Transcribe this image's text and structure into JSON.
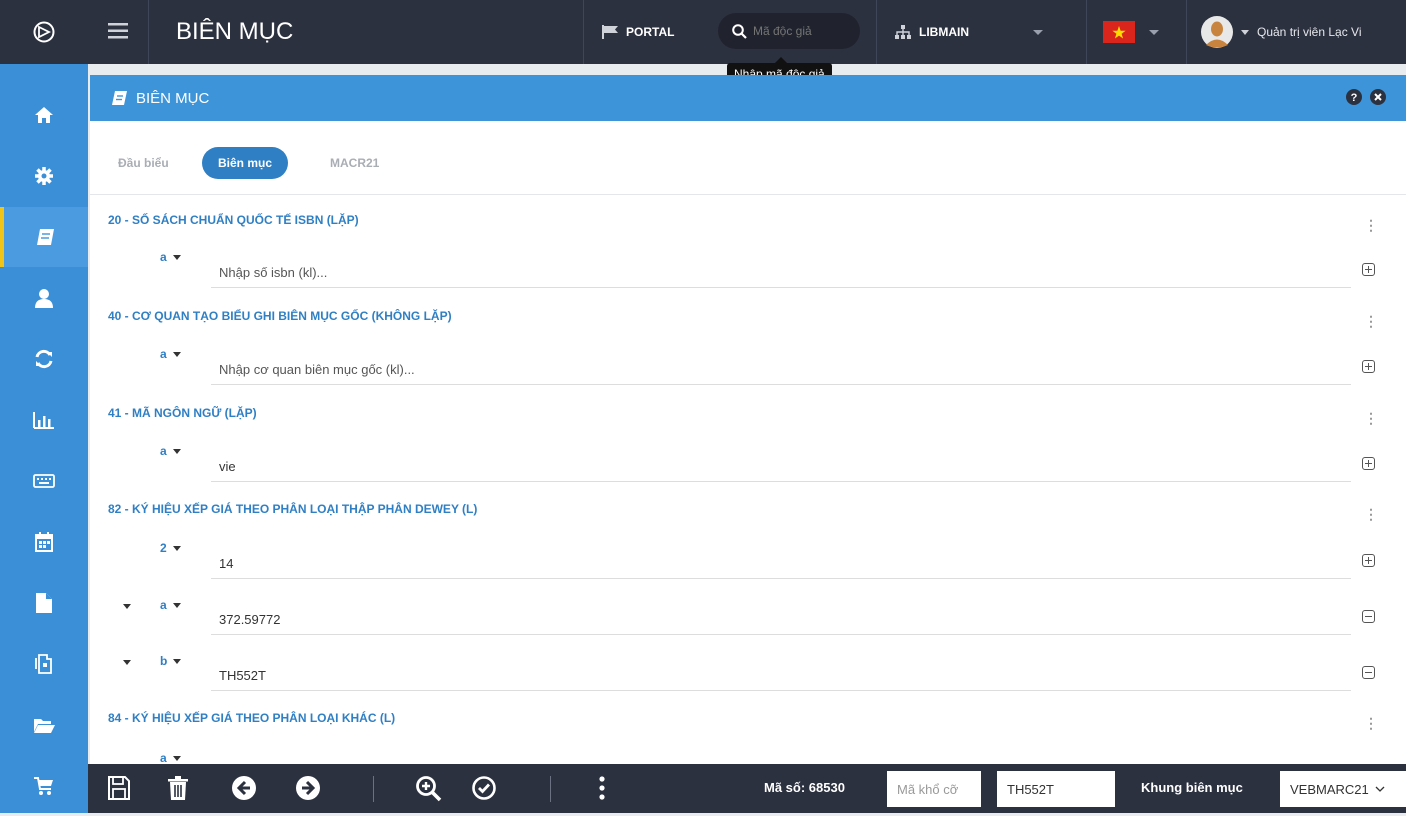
{
  "header": {
    "title": "BIÊN MỤC",
    "portal_label": "PORTAL",
    "search_placeholder": "Mã độc giả",
    "search_tooltip": "Nhập mã độc giả",
    "library": "LIBMAIN",
    "user_name": "Quản trị viên Lạc Vi"
  },
  "sidebar": {
    "items": [
      "home-icon",
      "gear-icon",
      "book-icon",
      "user-icon",
      "refresh-icon",
      "bar-chart-icon",
      "keyboard-icon",
      "calendar-icon",
      "file-icon",
      "copy-icon",
      "folder-icon",
      "cart-icon"
    ],
    "active_index": 2
  },
  "panel": {
    "title": "BIÊN MỤC"
  },
  "tabs": [
    "Đầu biểu",
    "Biên mục",
    "MACR21"
  ],
  "fields": [
    {
      "title": "20 - SỐ SÁCH CHUẨN QUỐC TẾ ISBN (LẶP)",
      "subfields": [
        {
          "code": "a",
          "value": "",
          "placeholder": "Nhập số isbn (kl)..."
        }
      ]
    },
    {
      "title": "40 - CƠ QUAN TẠO BIỂU GHI BIÊN MỤC GỐC (KHÔNG LẶP)",
      "subfields": [
        {
          "code": "a",
          "value": "",
          "placeholder": "Nhập cơ quan biên mục gốc (kl)..."
        }
      ]
    },
    {
      "title": "41 - MÃ NGÔN NGỮ (LẶP)",
      "subfields": [
        {
          "code": "a",
          "value": "vie",
          "placeholder": ""
        }
      ]
    },
    {
      "title": "82 - KÝ HIỆU XẾP GIÁ THEO PHÂN LOẠI THẬP PHÂN DEWEY (L)",
      "subfields": [
        {
          "code": "2",
          "value": "14",
          "placeholder": ""
        },
        {
          "code": "a",
          "value": "372.59772",
          "placeholder": ""
        },
        {
          "code": "b",
          "value": "TH552T",
          "placeholder": ""
        }
      ]
    },
    {
      "title": "84 - KÝ HIỆU XẾP GIÁ THEO PHÂN LOẠI KHÁC (L)",
      "subfields": [
        {
          "code": "a",
          "value": "",
          "placeholder": ""
        }
      ]
    }
  ],
  "footer": {
    "record_label": "Mã số: 68530",
    "size_placeholder": "Mã khổ cỡ",
    "call_value": "TH552T",
    "frame_label": "Khung biên mục",
    "frame_value": "VEBMARC21"
  }
}
